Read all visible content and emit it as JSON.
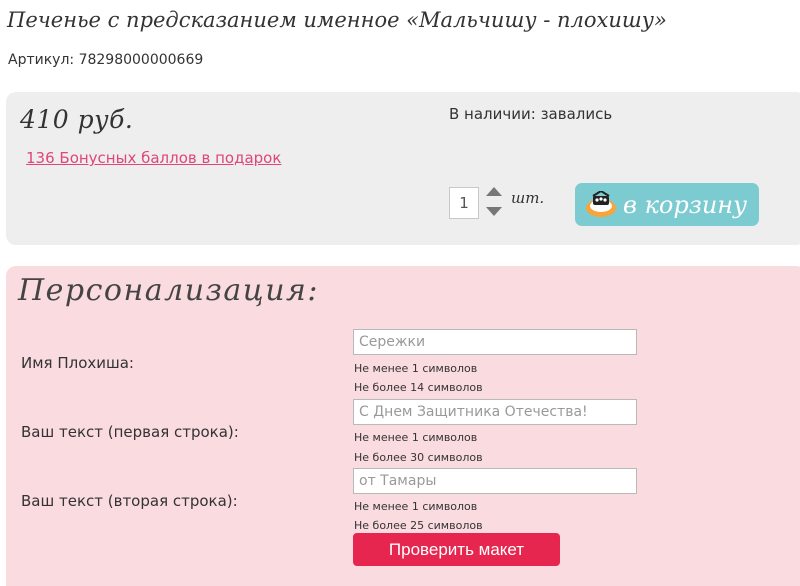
{
  "product": {
    "title": "Печенье с предсказанием именное «Мальчишу - плохишу»",
    "sku": "Артикул: 78298000000669"
  },
  "purchase": {
    "price": "410 руб.",
    "bonus_link": "136 Бонусных баллов в подарок",
    "stock": "В наличии: завались",
    "quantity": "1",
    "unit": "шт.",
    "cart_button_label": "в корзину",
    "cart_icon": "cookie-basket-icon",
    "panel_color": "#eeeeee",
    "accent_color": "#7ccbd1"
  },
  "personalization": {
    "heading": "Персонализация:",
    "panel_color": "#fadbe0",
    "fields": [
      {
        "label": "Имя Плохиша:",
        "value": "Сережки",
        "hint_min": "Не менее 1 символов",
        "hint_max": "Не более 14 символов"
      },
      {
        "label": "Ваш текст (первая строка):",
        "value": "С Днем Защитника Отечества!",
        "hint_min": "Не менее 1 символов",
        "hint_max": "Не более 30 символов"
      },
      {
        "label": "Ваш текст (вторая строка):",
        "value": "от Тамары",
        "hint_min": "Не менее 1 символов",
        "hint_max": "Не более 25 символов"
      }
    ],
    "check_button_label": "Проверить макет",
    "check_button_color": "#e6264f"
  }
}
